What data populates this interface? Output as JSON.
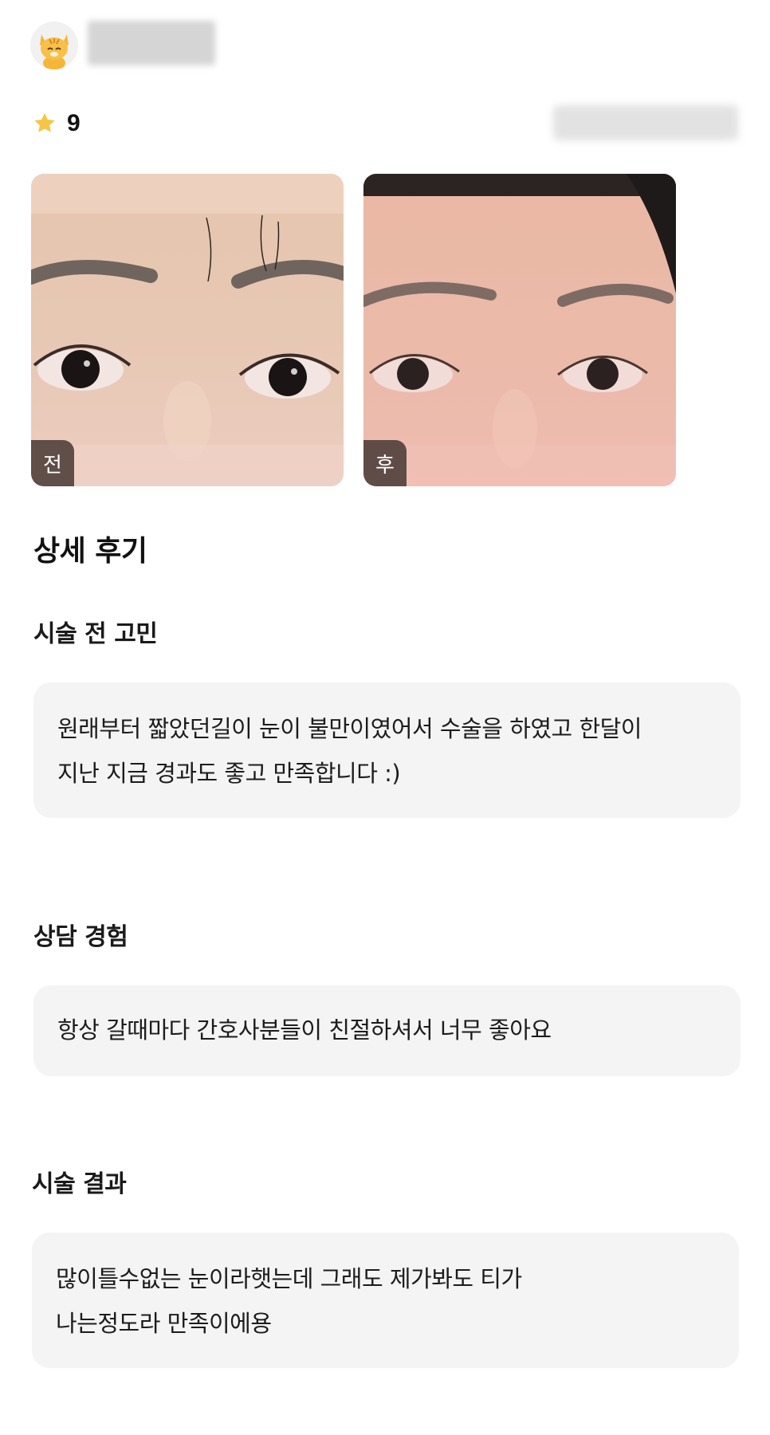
{
  "header": {
    "avatar_icon": "cat-avatar-icon",
    "rating_icon": "star-icon",
    "rating_value": "9"
  },
  "photos": [
    {
      "label": "전"
    },
    {
      "label": "후"
    }
  ],
  "detail": {
    "title": "상세 후기",
    "sections": [
      {
        "title": "시술 전 고민",
        "lines": [
          "원래부터 짧았던길이 눈이 불만이였어서 수술을 하였고 한달이",
          "지난 지금 경과도 좋고 만족합니다 :)"
        ]
      },
      {
        "title": "상담 경험",
        "lines": [
          "항상 갈때마다 간호사분들이 친절하셔서 너무 좋아요"
        ]
      },
      {
        "title": "시술 결과",
        "lines": [
          "많이틀수없는 눈이라햇는데 그래도 제가봐도 티가",
          "나는정도라 만족이에용"
        ]
      }
    ]
  },
  "colors": {
    "star": "#f6c543",
    "bubble_bg": "#f4f4f4",
    "tag_bg": "#46373280"
  }
}
